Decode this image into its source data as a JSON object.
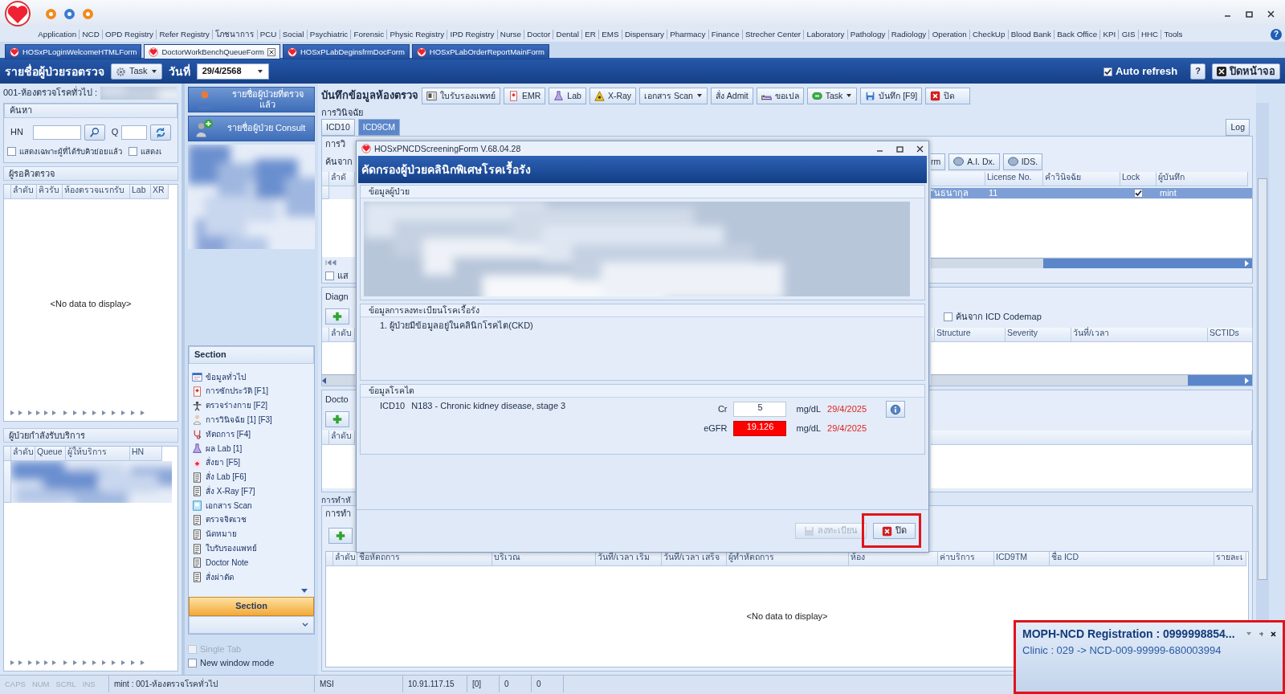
{
  "menu": [
    "Application",
    "NCD",
    "OPD Registry",
    "Refer Registry",
    "โภชนาการ",
    "PCU",
    "Social",
    "Psychiatric",
    "Forensic",
    "Physic Registry",
    "IPD Registry",
    "Nurse",
    "Doctor",
    "Dental",
    "ER",
    "EMS",
    "Dispensary",
    "Pharmacy",
    "Finance",
    "Strecher Center",
    "Laboratory",
    "Pathology",
    "Radiology",
    "Operation",
    "CheckUp",
    "Blood Bank",
    "Back Office",
    "KPI",
    "GIS",
    "HHC",
    "Tools"
  ],
  "help_button": "?",
  "doc_tabs": [
    {
      "label": "HOSxPLoginWelcomeHTMLForm",
      "selected": false,
      "closable": false
    },
    {
      "label": "DoctorWorkBenchQueueForm",
      "selected": true,
      "closable": true
    },
    {
      "label": "HOSxPLabDeginsfrmDocForm",
      "selected": false,
      "closable": false
    },
    {
      "label": "HOSxPLabOrderReportMainForm",
      "selected": false,
      "closable": false
    }
  ],
  "header": {
    "title": "รายชื่อผู้ป่วยรอตรวจ",
    "task_button": "Task",
    "date_label": "วันที่",
    "date": "29/4/2568",
    "auto_refresh": {
      "label": "Auto refresh",
      "checked": true
    },
    "help_button": "?",
    "close_button": "ปิดหน้าจอ"
  },
  "left_panel": {
    "room": "001-ห้องตรวจโรคทั่วไป :",
    "search": {
      "title": "ค้นหา",
      "hn_label": "HN",
      "q_label": "Q",
      "checkboxes": [
        {
          "label": "แสดงเฉพาะผู้ที่ได้รับคิวย่อยแล้ว",
          "checked": false
        },
        {
          "label": "แสดงเ",
          "checked": false
        }
      ]
    },
    "waiting": {
      "title": "ผู้รอคิวตรวจ",
      "columns": [
        "ลำดับ",
        "คิวรับ",
        "ห้องตรวจแรกรับ",
        "Lab",
        "XR"
      ],
      "empty_text": "<No data to display>"
    },
    "serving": {
      "title": "ผู้ป่วยกำลังรับบริการ",
      "columns": [
        "ลำดับ",
        "Queue",
        "ผู้ให้บริการ",
        "HN"
      ]
    }
  },
  "nav": {
    "buttons": [
      "รายชื่อผู้ป่วยที่ตรวจแล้ว",
      "รายชื่อผู้ป่วย Consult"
    ],
    "section": {
      "title": "Section",
      "items": [
        "ข้อมูลทั่วไป",
        "การซักประวัติ [F1]",
        "ตรวจร่างกาย [F2]",
        "การวินิจฉัย [1] [F3]",
        "หัตถการ [F4]",
        "ผล Lab [1]",
        "สั่งยา [F5]",
        "สั่ง Lab [F6]",
        "สั่ง X-Ray [F7]",
        "เอกสาร Scan",
        "ตรวจจิตเวช",
        "นัดหมาย",
        "ใบรับรองแพทย์",
        "Doctor Note",
        "สั่งผ่าตัด"
      ],
      "button": "Section"
    },
    "options": [
      {
        "label": "Single Tab",
        "checked": false,
        "disabled": true
      },
      {
        "label": "New window mode",
        "checked": false,
        "disabled": false
      }
    ]
  },
  "main": {
    "toolbar": {
      "title": "บันทึกข้อมูลห้องตรวจ",
      "buttons": [
        {
          "label": "ใบรับรองแพทย์",
          "dropdown": false
        },
        {
          "label": "EMR",
          "dropdown": false
        },
        {
          "label": "Lab",
          "dropdown": false
        },
        {
          "label": "X-Ray",
          "dropdown": false
        },
        {
          "label": "เอกสาร Scan",
          "dropdown": true
        },
        {
          "label": "สั่ง Admit",
          "dropdown": false
        },
        {
          "label": "ขอเปล",
          "dropdown": false
        },
        {
          "label": "Task",
          "dropdown": true
        },
        {
          "label": "บันทึก [F9]",
          "dropdown": false
        },
        {
          "label": "ปิด",
          "dropdown": false
        }
      ]
    },
    "diagnosis_label": "การวินิจฉัย",
    "tabs": [
      {
        "label": "ICD10",
        "selected": false
      },
      {
        "label": "ICD9CM",
        "selected": true
      }
    ],
    "log_button": "Log",
    "icd_panel": {
      "subtab": "การวิ",
      "search_label": "ค้นจาก",
      "buttons": [
        "rm",
        "A.I. Dx.",
        "IDS."
      ],
      "first_column": "ลำดั",
      "columns": [
        "",
        "License No.",
        "คำวินิจฉัย",
        "Lock",
        "ผู้บันทึก"
      ],
      "rows": [
        {
          "selected": true,
          "cells": [
            "ันธนากุล",
            "11",
            ""
          ],
          "lock": true,
          "recorder": "mint"
        }
      ],
      "checkbox": {
        "label": "แส",
        "checked": false
      }
    },
    "diagnosis_panel": {
      "title": "Diagn",
      "codemap": {
        "label": "ค้นจาก ICD Codemap",
        "checked": false
      },
      "first_column": "ลำดับ",
      "columns": [
        "Structure",
        "Severity",
        "วันที่/เวลา",
        "SCTIDs"
      ]
    },
    "doctor_panel": {
      "title": "Docto",
      "first_column": "ลำดับ"
    },
    "procedure_panel": {
      "title": "การทำหั",
      "subtab": "การทำ",
      "columns": [
        "ลำดับ",
        "ชื่อหัตถการ",
        "บริเวณ",
        "วันที่/เวลา เริ่ม",
        "วันที่/เวลา เสร็จ",
        "ผู้ทำหัตถการ",
        "ห้อง",
        "ค่าบริการ",
        "ICD9TM",
        "ชื่อ ICD",
        "รายละเ"
      ],
      "empty_text": "<No data to display>"
    }
  },
  "dialog": {
    "title": "HOSxPNCDScreeningForm V.68.04.28",
    "heading": "คัดกรองผู้ป่วยคลินิกพิเศษโรคเรื้อรัง",
    "patient_group": {
      "title": "ข้อมูลผู้ป่วย",
      "kind": "picture"
    },
    "registration_group": {
      "title": "ข้อมูลการลงทะเบียนโรคเรื้อรัง",
      "items": [
        "1. ผู้ป่วยมีข้อมูลอยู่ในคลินิกโรคไต(CKD)"
      ]
    },
    "kidney_group": {
      "title": "ข้อมูลโรคไต",
      "code_system": "ICD10",
      "diagnosis": "N183 - Chronic kidney disease, stage 3",
      "labs": [
        {
          "name": "Cr",
          "value": "5",
          "abnormal": false,
          "unit": "mg/dL",
          "date": "29/4/2025"
        },
        {
          "name": "eGFR",
          "value": "19.126",
          "abnormal": true,
          "unit": "mg/dL",
          "date": "29/4/2025"
        }
      ]
    },
    "buttons": [
      {
        "label": "ลงทะเบียน",
        "disabled": true,
        "highlighted": false
      },
      {
        "label": "ปิด",
        "disabled": false,
        "highlighted": true
      }
    ]
  },
  "notification": {
    "title": "MOPH-NCD Registration : 0999998854...",
    "text": "Clinic : 029 -> NCD-009-99999-680003994"
  },
  "status_bar": {
    "keys": [
      "CAPS",
      "NUM",
      "SCRL",
      "INS"
    ],
    "cells": [
      "mint : 001-ห้องตรวจโรคทั่วไป",
      "MSI",
      "10.91.117.15",
      "[0]",
      "0",
      "0"
    ]
  }
}
